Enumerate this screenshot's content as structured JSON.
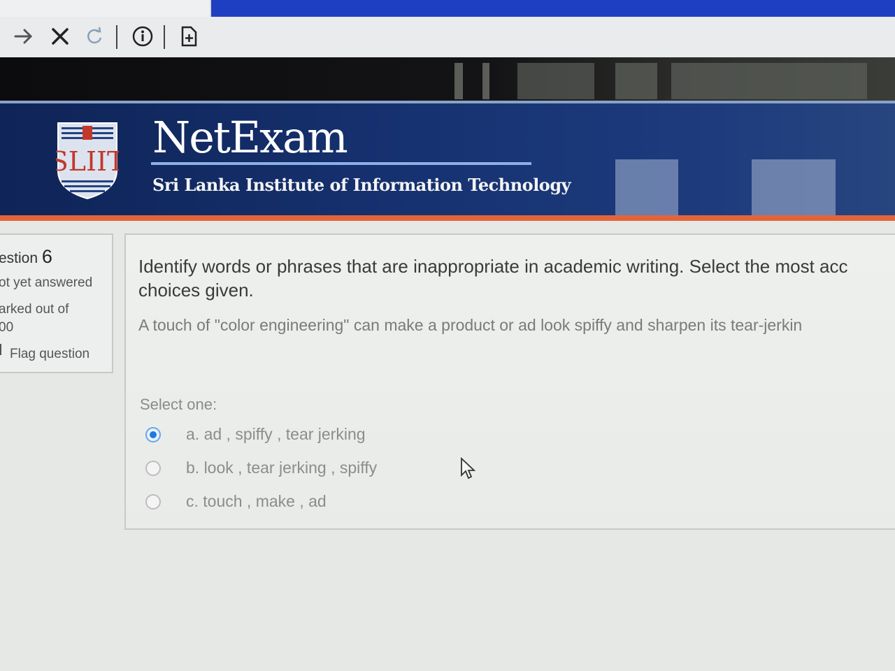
{
  "browser": {
    "icons": [
      "forward-arrow-icon",
      "close-icon",
      "reload-icon",
      "info-icon",
      "document-add-icon"
    ]
  },
  "header": {
    "logo_text": "SLIIT",
    "title": "NetExam",
    "subtitle": "Sri Lanka Institute of Information Technology"
  },
  "question_info": {
    "label": "estion",
    "number": "6",
    "status": "ot yet answered",
    "marked_label": "arked out of",
    "points": "00",
    "flag_label": "Flag question"
  },
  "question": {
    "prompt_line1": "Identify words or phrases that are inappropriate in academic writing. Select the most acc",
    "prompt_line2": "choices given.",
    "passage": "A touch of \"color engineering\" can make a product or ad look spiffy and sharpen its tear-jerkin",
    "select_label": "Select one:",
    "options": [
      {
        "text": "a. ad , spiffy , tear jerking",
        "selected": true
      },
      {
        "text": "b. look , tear jerking , spiffy",
        "selected": false
      },
      {
        "text": "c. touch , make , ad",
        "selected": false
      }
    ]
  },
  "colors": {
    "banner_blue": "#15306d",
    "accent_orange": "#e4643a",
    "radio_selected": "#1f7ae0"
  }
}
